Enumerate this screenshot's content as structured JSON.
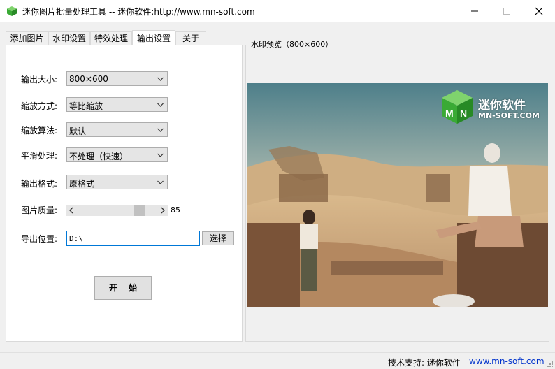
{
  "window": {
    "title": "迷你图片批量处理工具 -- 迷你软件:http://www.mn-soft.com"
  },
  "tabs": [
    {
      "label": "添加图片"
    },
    {
      "label": "水印设置"
    },
    {
      "label": "特效处理"
    },
    {
      "label": "输出设置"
    },
    {
      "label": "关于"
    }
  ],
  "settings": {
    "output_size": {
      "label": "输出大小:",
      "value": "800×600"
    },
    "scale_mode": {
      "label": "缩放方式:",
      "value": "等比缩放"
    },
    "scale_algo": {
      "label": "缩放算法:",
      "value": "默认"
    },
    "smoothing": {
      "label": "平滑处理:",
      "value": "不处理（快速）"
    },
    "format": {
      "label": "输出格式:",
      "value": "原格式"
    },
    "quality": {
      "label": "图片质量:",
      "value": "85",
      "level": 85
    },
    "export": {
      "label": "导出位置:",
      "value": "D:\\",
      "browse_label": "选择"
    }
  },
  "start_label": "开 始",
  "preview": {
    "caption": "水印预览（800×600）",
    "watermark_text": "迷你软件",
    "watermark_sub": "MN-SOFT.COM"
  },
  "status": {
    "support_label": "技术支持: 迷你软件",
    "support_link": "www.mn-soft.com"
  },
  "colors": {
    "accent": "#0078d7",
    "link": "#0033cc",
    "logo_green": "#3aaa35"
  }
}
